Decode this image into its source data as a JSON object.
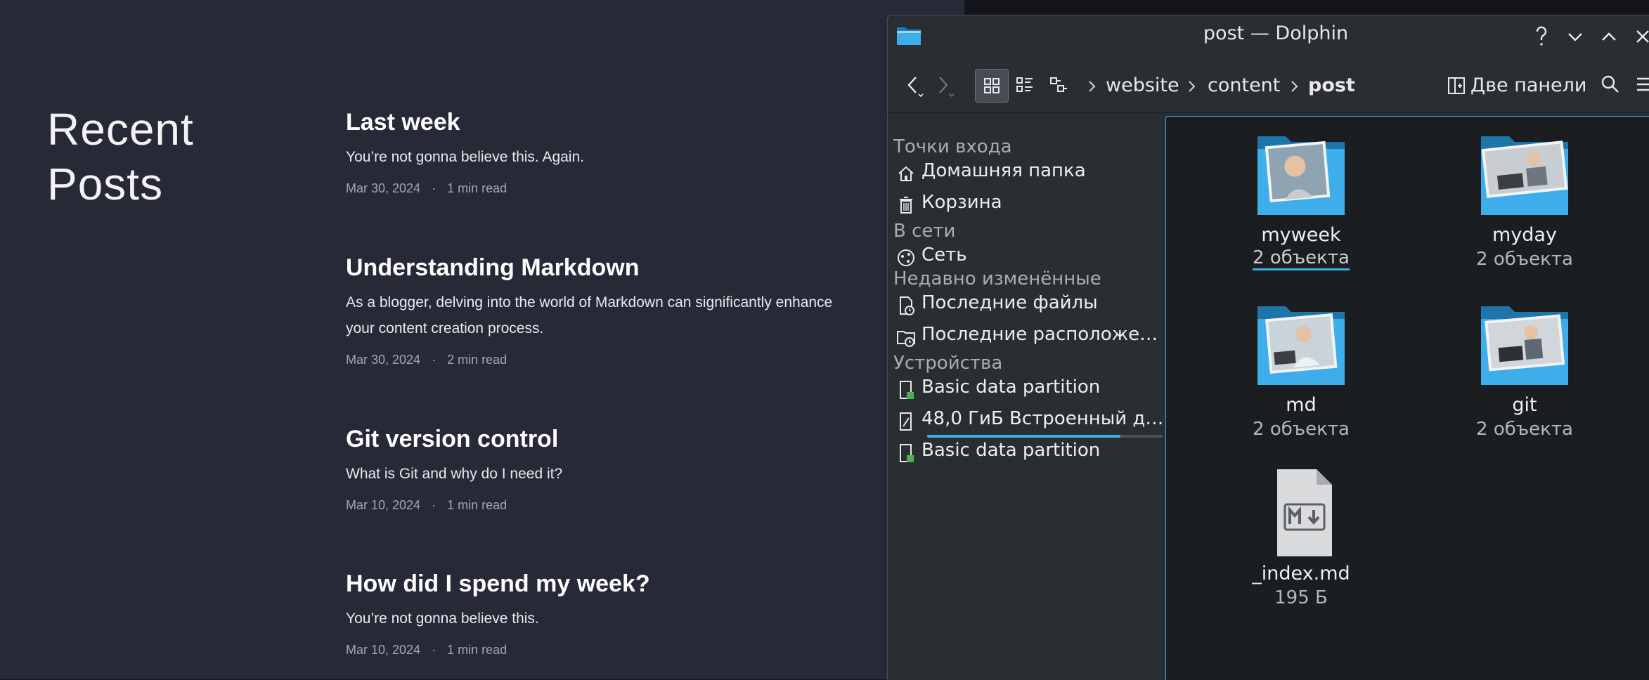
{
  "blog": {
    "section_title_line1": "Recent",
    "section_title_line2": "Posts",
    "posts": [
      {
        "title": "Last week",
        "description": "You’re not gonna believe this. Again.",
        "date": "Mar 30, 2024",
        "separator": "·",
        "read_time": "1 min read"
      },
      {
        "title": "Understanding Markdown",
        "description_line1": "As a blogger, delving into the world of Markdown can significantly enhance",
        "description_line2": "your content creation process.",
        "date": "Mar 30, 2024",
        "separator": "·",
        "read_time": "2 min read"
      },
      {
        "title": "Git version control",
        "description": "What is Git and why do I need it?",
        "date": "Mar 10, 2024",
        "separator": "·",
        "read_time": "1 min read"
      },
      {
        "title": "How did I spend my week?",
        "description": "You’re not gonna believe this.",
        "date": "Mar 10, 2024",
        "separator": "·",
        "read_time": "1 min read"
      }
    ]
  },
  "dolphin": {
    "window_title": "post — Dolphin",
    "breadcrumb": [
      "website",
      "content",
      "post"
    ],
    "split_label": "Две панели",
    "places": {
      "sections": {
        "entry_points": "Точки входа",
        "network": "В сети",
        "recent": "Недавно изменённые",
        "devices": "Устройства"
      },
      "home": "Домашняя папка",
      "trash": "Корзина",
      "network_item": "Сеть",
      "recent_files": "Последние файлы",
      "recent_locations": "Последние расположе…",
      "device1": "Basic data partition",
      "device2": "48,0 ГиБ Встроенный д…",
      "device2_usage": 0.82,
      "device3": "Basic data partition"
    },
    "items": [
      {
        "name": "myweek",
        "info": "2 объекта"
      },
      {
        "name": "myday",
        "info": "2 объекта"
      },
      {
        "name": "md",
        "info": "2 объекта"
      },
      {
        "name": "git",
        "info": "2 объекта"
      },
      {
        "name": "_index.md",
        "info": "195 Б"
      }
    ],
    "colors": {
      "accent": "#3daee9",
      "folder": "#3daee9"
    }
  }
}
